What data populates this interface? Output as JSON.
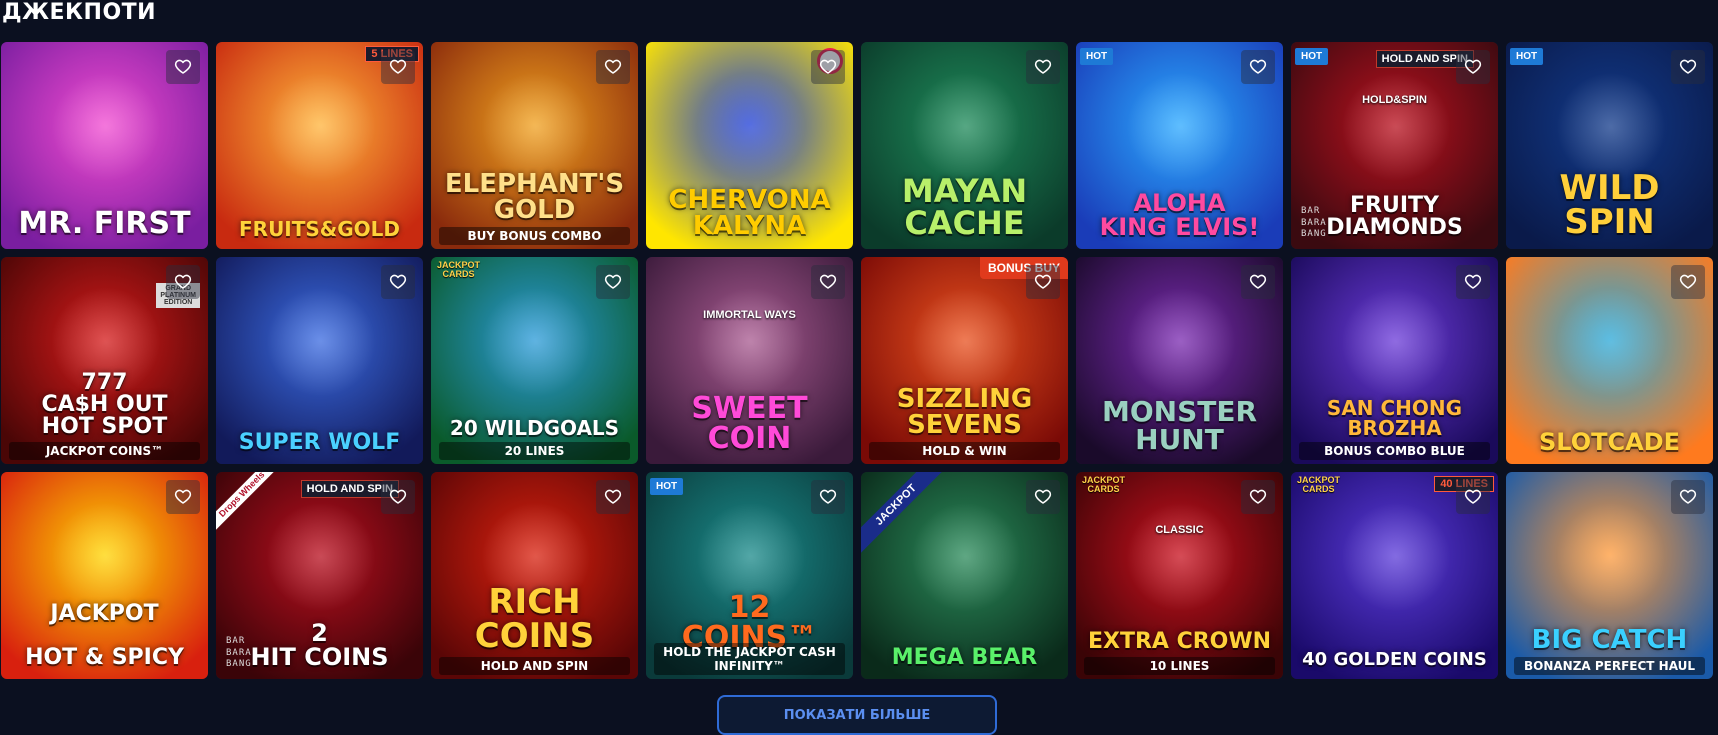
{
  "section": {
    "title": "ДЖЕКПОТИ"
  },
  "show_more_label": "ПОКАЗАТИ БІЛЬШЕ",
  "favorite_icon": "heart-outline-icon",
  "games": [
    {
      "id": "mr-first",
      "title": "Mr. FIRST",
      "colors": [
        "#f04ad0",
        "#7a1ea0"
      ],
      "title_color": "#ffffff",
      "title_size": 30,
      "badge": null
    },
    {
      "id": "fruits-gold",
      "title": "FRUITS&GOLD",
      "colors": [
        "#ffb33a",
        "#c82a10"
      ],
      "title_color": "#ffd23a",
      "title_size": 20,
      "badge": {
        "type": "lines",
        "text": "5 LINES"
      }
    },
    {
      "id": "elephants-gold",
      "title": "ELEPHANT'S\nGOLD",
      "subtitle": "BUY BONUS COMBO",
      "colors": [
        "#f0a01e",
        "#8a2a0c"
      ],
      "title_color": "#ffe08a",
      "title_size": 26,
      "badge": null
    },
    {
      "id": "chervona-kalyna",
      "title": "CHERVONA\nKALYNA",
      "colors": [
        "#1f3fd8",
        "#ffe600"
      ],
      "title_color": "#ffcc00",
      "title_size": 26,
      "badge": {
        "type": "logo"
      }
    },
    {
      "id": "mayan-cache",
      "title": "MAYAN\nCACHE",
      "colors": [
        "#1e8a5a",
        "#0b3b2a"
      ],
      "title_color": "#b8f06a",
      "title_size": 32,
      "badge": null
    },
    {
      "id": "aloha-king-elvis",
      "title": "Aloha\nKING ELVIS!",
      "colors": [
        "#2aa8ff",
        "#1a3cb8"
      ],
      "title_color": "#ff4aa0",
      "title_size": 24,
      "badge": {
        "type": "hot",
        "text": "HOT"
      }
    },
    {
      "id": "fruity-diamonds",
      "title": "Fruity\nDIAMONDS",
      "colors": [
        "#b8101e",
        "#3a0a10"
      ],
      "title_color": "#ffffff",
      "title_size": 22,
      "badge": {
        "type": "hot-hold",
        "text": "HOT",
        "hold": "HOLD AND SPIN"
      },
      "provider": "BAR\nBARA\nBANG",
      "extra": "HOLD&SPIN"
    },
    {
      "id": "wild-spin",
      "title": "WILD\nSpin",
      "colors": [
        "#123a8a",
        "#0a1a4a"
      ],
      "title_color": "#ffcf3a",
      "title_size": 34,
      "badge": {
        "type": "hot",
        "text": "HOT"
      }
    },
    {
      "id": "777-cash-out",
      "title": "777\nCA$H OUT\nHOT SPOT",
      "subtitle": "JACKPOT COINS™",
      "colors": [
        "#d41a1a",
        "#4a0606"
      ],
      "title_color": "#ffffff",
      "title_size": 22,
      "badge": {
        "type": "grand",
        "text": "GRAND\nPLATINUM\nEDITION"
      }
    },
    {
      "id": "super-wolf",
      "title": "SUPER WOLF",
      "colors": [
        "#3a6ae0",
        "#121a5a"
      ],
      "title_color": "#4ad0ff",
      "title_size": 22,
      "badge": null
    },
    {
      "id": "20-wild-goals",
      "title": "20 WILDGOALS",
      "subtitle": "20 LINES",
      "colors": [
        "#2a9ad8",
        "#0a5a2a"
      ],
      "title_color": "#ffffff",
      "title_size": 20,
      "badge": {
        "type": "jackpotcards",
        "text": "JACKPOT\nCARDS"
      }
    },
    {
      "id": "sweet-coin",
      "title": "SWEET\nCOIN",
      "extra": "IMMORTAL WAYS",
      "colors": [
        "#a85a90",
        "#3a1a3a"
      ],
      "title_color": "#ff4ad8",
      "title_size": 30,
      "badge": null
    },
    {
      "id": "sizzling-sevens",
      "title": "SIZZLING\nSEVENS",
      "subtitle": "HOLD & WIN",
      "colors": [
        "#e8501e",
        "#7a0a06"
      ],
      "title_color": "#ffd23a",
      "title_size": 26,
      "badge": {
        "type": "bonus",
        "text": "BONUS BUY"
      }
    },
    {
      "id": "monster-hunt",
      "title": "Monster\nHunt",
      "colors": [
        "#7a2ab0",
        "#1a0a2a"
      ],
      "title_color": "#9ad0c0",
      "title_size": 28,
      "badge": null
    },
    {
      "id": "san-chong-brozha",
      "title": "SAN CHONG\nBROZHA",
      "subtitle": "BONUS COMBO BLUE",
      "colors": [
        "#6a3ad8",
        "#1a0a5a"
      ],
      "title_color": "#ffb83a",
      "title_size": 20,
      "badge": null
    },
    {
      "id": "slotcade",
      "title": "SLOTCADE",
      "colors": [
        "#2aa8d8",
        "#ff7a1e"
      ],
      "title_color": "#ffd23a",
      "title_size": 24,
      "badge": null
    },
    {
      "id": "jackpot-hot-spicy",
      "title": "JACKPOT\n\nHOT & SPICY",
      "colors": [
        "#ffd400",
        "#d8200e"
      ],
      "title_color": "#ffffff",
      "title_size": 22,
      "badge": null
    },
    {
      "id": "2-hit-coins",
      "title": "2\nHIT COINS",
      "colors": [
        "#b80e1e",
        "#3a0408"
      ],
      "title_color": "#ffffff",
      "title_size": 24,
      "badge": {
        "type": "drops-hold",
        "text": "Drops Wheels",
        "hold": "HOLD AND SPIN"
      },
      "provider": "BAR\nBARA\nBANG"
    },
    {
      "id": "rich-coins",
      "title": "RICH\nCOINS",
      "subtitle": "HOLD AND SPIN",
      "colors": [
        "#d8200e",
        "#5a0606"
      ],
      "title_color": "#ffd23a",
      "title_size": 34,
      "badge": null
    },
    {
      "id": "12-coins",
      "title": "12\nCOINS™",
      "subtitle": "HOLD THE JACKPOT CASH INFINITY™",
      "colors": [
        "#1a8a8a",
        "#0a3a3a"
      ],
      "title_color": "#ff6a1e",
      "title_size": 30,
      "badge": {
        "type": "hot",
        "text": "HOT"
      }
    },
    {
      "id": "mega-bear",
      "title": "MEGA BEAR",
      "colors": [
        "#2a8a5a",
        "#0a2a1a"
      ],
      "title_color": "#5af06a",
      "title_size": 22,
      "badge": {
        "type": "jackpot-ribbon",
        "text": "JACKPOT"
      }
    },
    {
      "id": "extra-crown",
      "title": "Extra Crown",
      "extra": "CLASSIC",
      "subtitle": "10 LINES",
      "colors": [
        "#c8101e",
        "#3a0406"
      ],
      "title_color": "#ffd23a",
      "title_size": 22,
      "badge": {
        "type": "jackpotcards",
        "text": "JACKPOT\nCARDS"
      }
    },
    {
      "id": "40-golden-coins",
      "title": "40 GOLDEN COINS",
      "colors": [
        "#5a3ad8",
        "#1a0a6a"
      ],
      "title_color": "#ffffff",
      "title_size": 18,
      "badge": {
        "type": "jackpotcards-lines",
        "text": "JACKPOT\nCARDS",
        "lines": "40 LINES"
      }
    },
    {
      "id": "big-catch-bonanza",
      "title": "BIG CATCH",
      "subtitle": "BONANZA PERFECT HAUL",
      "colors": [
        "#ff9a3a",
        "#1a5aa8"
      ],
      "title_color": "#3ad0ff",
      "title_size": 26,
      "badge": null
    }
  ]
}
